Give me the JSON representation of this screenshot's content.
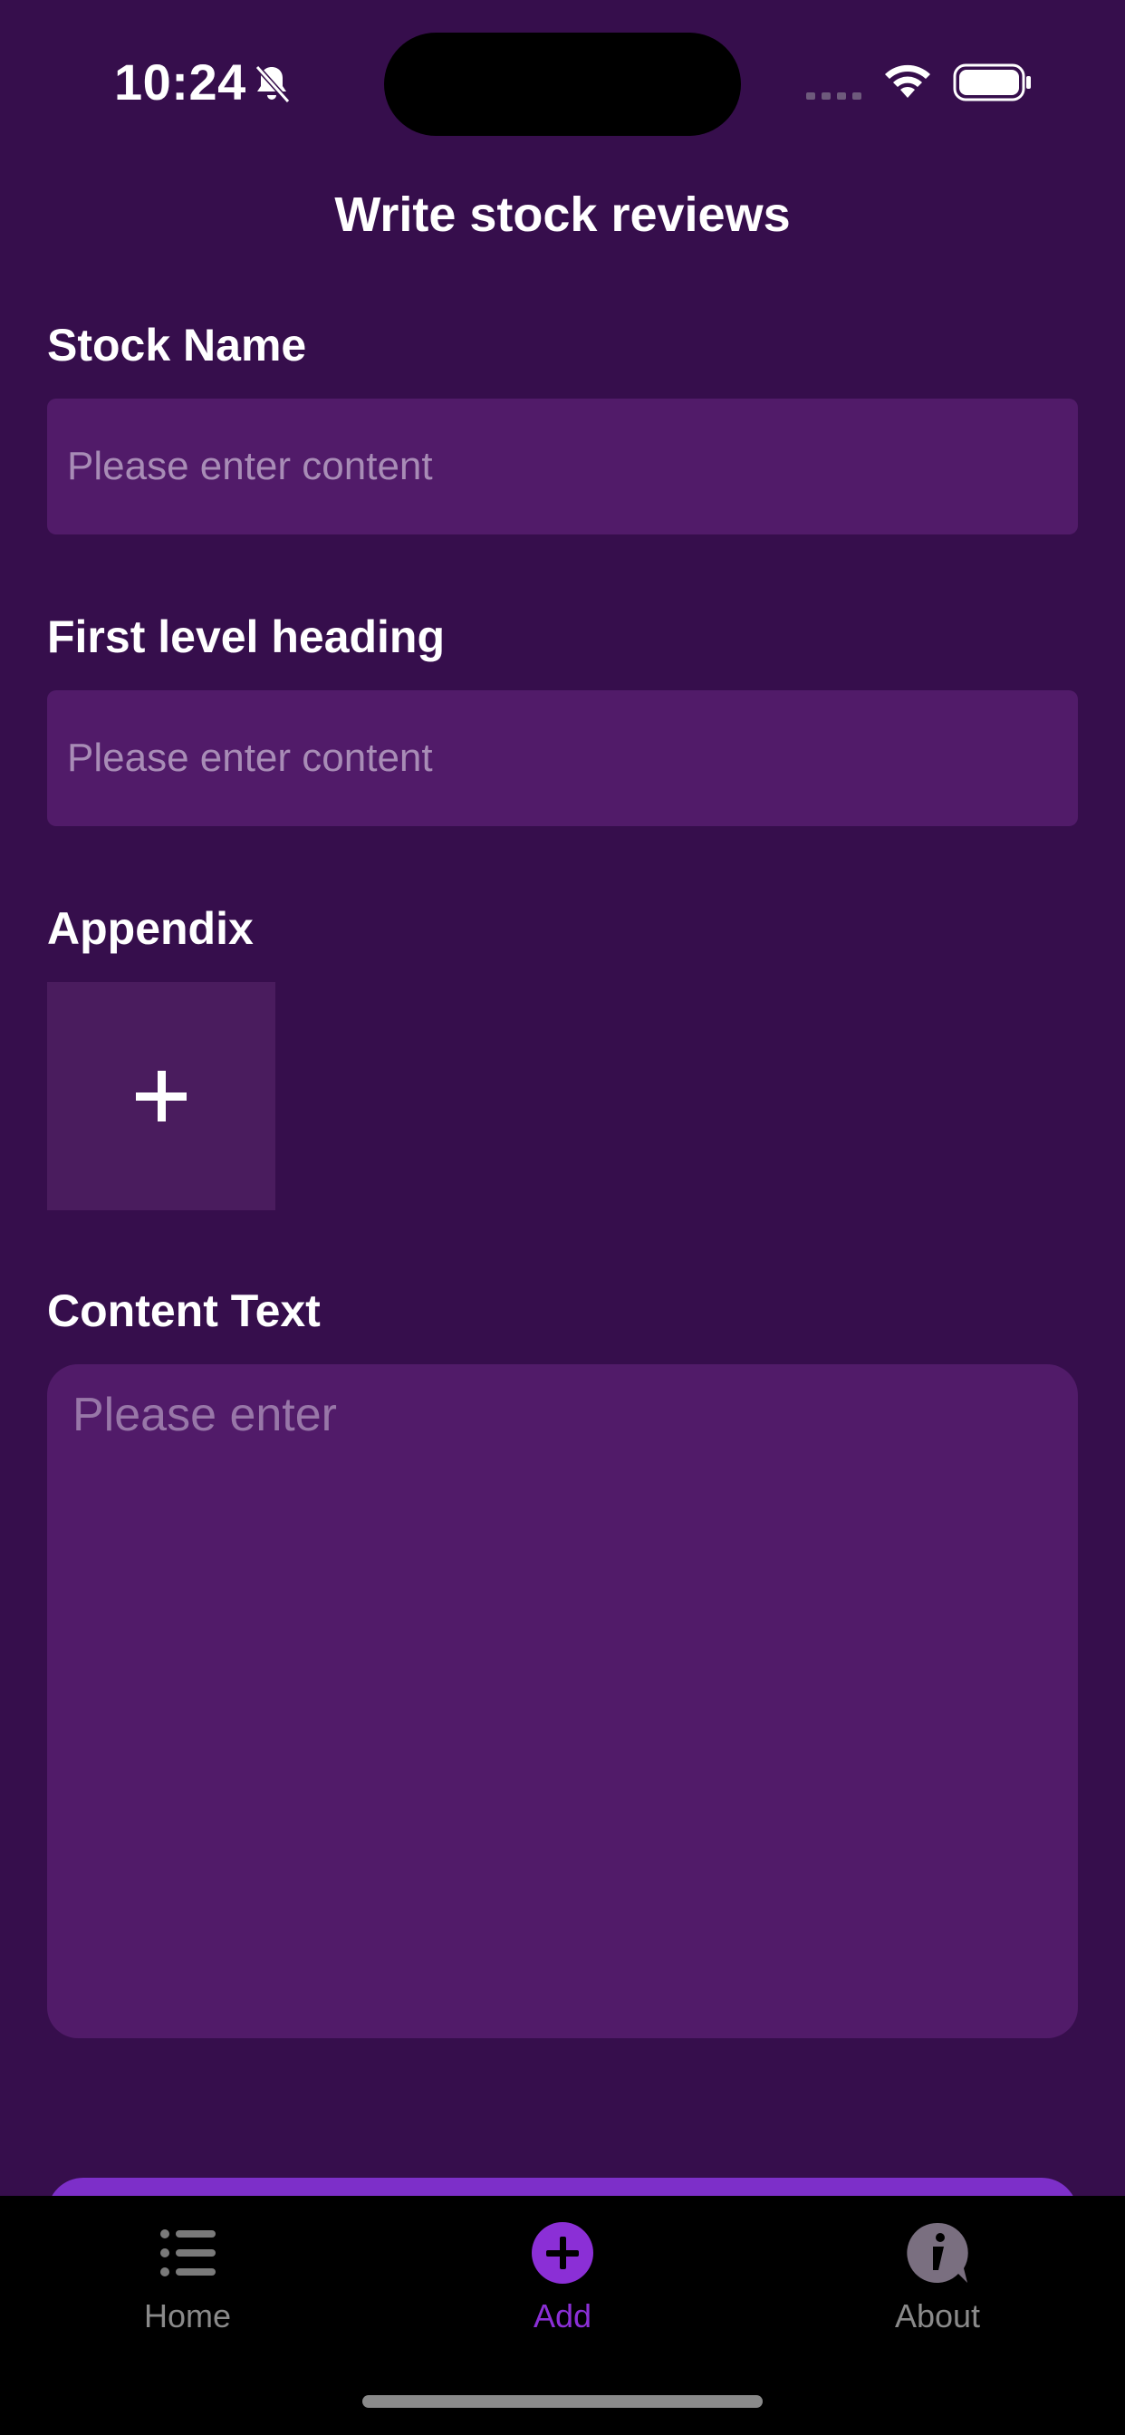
{
  "status_bar": {
    "time": "10:24"
  },
  "header": {
    "title": "Write stock reviews"
  },
  "form": {
    "stock_name": {
      "label": "Stock Name",
      "value": "",
      "placeholder": "Please enter content"
    },
    "first_level_heading": {
      "label": "First level heading",
      "value": "",
      "placeholder": "Please enter content"
    },
    "appendix": {
      "label": "Appendix",
      "add_icon": "plus-icon"
    },
    "content_text": {
      "label": "Content Text",
      "value": "",
      "placeholder": "Please enter"
    }
  },
  "tab_bar": {
    "tabs": [
      {
        "label": "Home",
        "icon": "list-icon",
        "active": false
      },
      {
        "label": "Add",
        "icon": "plus-circle-icon",
        "active": true
      },
      {
        "label": "About",
        "icon": "info-bubble-icon",
        "active": false
      }
    ]
  },
  "colors": {
    "background": "#360e4c",
    "input_background": "#511b69",
    "upload_background": "#4a1c5e",
    "accent": "#7d2fc9",
    "tab_active": "#8b2fd6",
    "tab_inactive": "#8a8a8a",
    "tab_bar_background": "#000000"
  }
}
